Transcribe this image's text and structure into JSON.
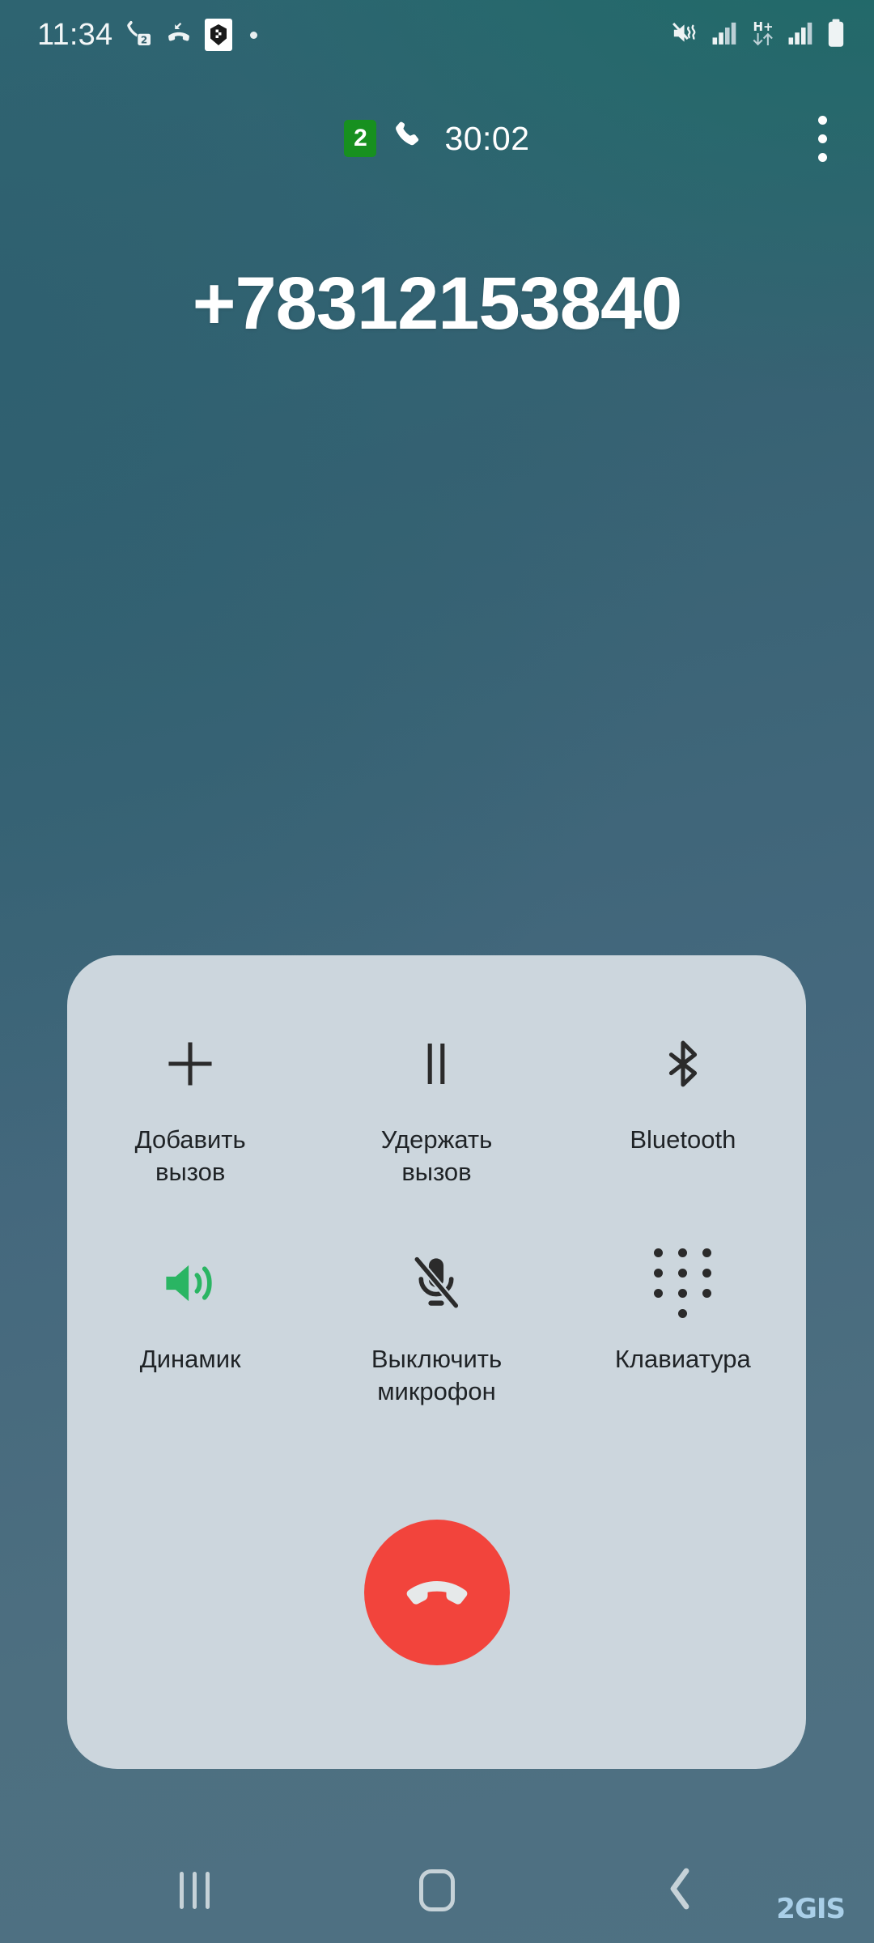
{
  "status_bar": {
    "time": "11:34",
    "left_icons": [
      {
        "name": "phone-sim2-icon",
        "label": "phone with SIM 2 badge"
      },
      {
        "name": "missed-call-icon",
        "label": "missed call"
      },
      {
        "name": "app-notification-icon",
        "label": "app notification"
      },
      {
        "name": "notification-dot-icon",
        "label": "more notifications"
      }
    ],
    "right_icons": [
      {
        "name": "vibrate-mute-icon",
        "label": "sound off / vibrate"
      },
      {
        "name": "signal-sim1-icon",
        "label": "signal strength SIM 1"
      },
      {
        "name": "network-hplus-icon",
        "label": "H+",
        "text": "H+"
      },
      {
        "name": "signal-sim2-icon",
        "label": "signal strength SIM 2"
      },
      {
        "name": "battery-icon",
        "label": "battery full"
      }
    ]
  },
  "call": {
    "sim_badge": "2",
    "duration": "30:02",
    "phone_number": "+78312153840",
    "overflow_label": "More options"
  },
  "controls": {
    "buttons": [
      {
        "id": "add-call",
        "icon": "plus-icon",
        "label": "Добавить\nвызов",
        "label_lines": [
          "Добавить",
          "вызов"
        ],
        "active": false
      },
      {
        "id": "hold-call",
        "icon": "pause-icon",
        "label": "Удержать\nвызов",
        "label_lines": [
          "Удержать",
          "вызов"
        ],
        "active": false
      },
      {
        "id": "bluetooth",
        "icon": "bluetooth-icon",
        "label": "Bluetooth",
        "label_lines": [
          "Bluetooth"
        ],
        "active": false
      },
      {
        "id": "speaker",
        "icon": "speaker-icon",
        "label": "Динамик",
        "label_lines": [
          "Динамик"
        ],
        "active": true
      },
      {
        "id": "mute-mic",
        "icon": "mic-off-icon",
        "label": "Выключить\nмикрофон",
        "label_lines": [
          "Выключить",
          "микрофон"
        ],
        "active": false
      },
      {
        "id": "keypad",
        "icon": "dialpad-icon",
        "label": "Клавиатура",
        "label_lines": [
          "Клавиатура"
        ],
        "active": false
      }
    ],
    "end_call": {
      "icon": "end-call-icon",
      "label": "Завершить вызов"
    }
  },
  "nav_bar": {
    "recents_label": "Recents",
    "home_label": "Home",
    "back_label": "Back",
    "watermark": "2GIS"
  },
  "colors": {
    "panel_bg": "#ccd6dd",
    "end_call": "#f2443c",
    "speaker_active": "#2ab563",
    "sim_badge": "#17901f",
    "icon_dark": "#2b2b2b",
    "watermark": "#a9cfe8"
  }
}
